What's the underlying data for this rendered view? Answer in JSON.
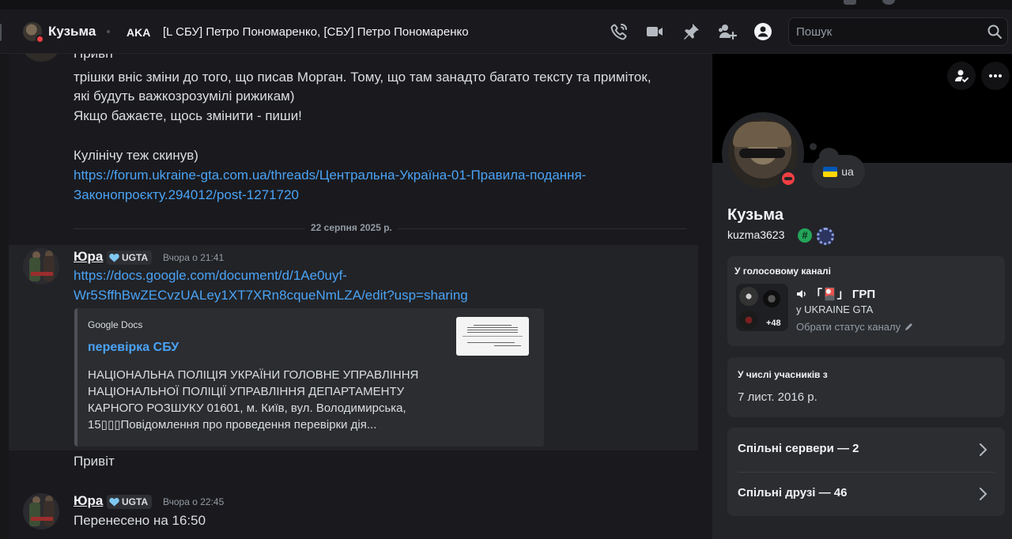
{
  "header": {
    "dm_name": "Кузьма",
    "aka_label": "AKA",
    "aka_names": "[L СБУ] Петро Пономаренко, [СБУ] Петро Пономаренко",
    "search_placeholder": "Пошук"
  },
  "chat": {
    "partial_message": {
      "lines": [
        "Привіт",
        "трішки вніс зміни до того, що писав Морган. Тому, що там занадто багато тексту та приміток,",
        "які будуть важкозрозумілі рижикам)",
        "Якщо бажаєте, щось змінити - пиши!",
        "Кулінічу теж скинув)"
      ],
      "link_line1": "https://forum.ukraine-gta.com.ua/threads/Центральна-Україна-01-Правила-подання-",
      "link_line2": "Законопроєкту.294012/post-1271720"
    },
    "date_divider": "22 серпня 2025 р.",
    "messages": [
      {
        "author": "Юра",
        "tag": "UGTA",
        "timestamp": "Вчора о 21:41",
        "link_line1": "https://docs.google.com/document/d/1Ae0uyf-",
        "link_line2": "Wr5SffhBwZECvzUALey1XT7XRn8cqueNmLZA/edit?usp=sharing",
        "embed": {
          "provider": "Google Docs",
          "title": "перевірка СБУ",
          "description": "НАЦІОНАЛЬНА ПОЛІЦІЯ УКРАЇНИ ГОЛОВНЕ УПРАВЛІННЯ НАЦІОНАЛЬНОЇ ПОЛІЦІЇ УПРАВЛІННЯ ДЕПАРТАМЕНТУ КАРНОГО РОЗШУКУ 01601, м. Київ, вул. Володимирська, 15▯▯▯Повідомлення про проведення перевірки дія..."
        },
        "followup": "Привіт"
      },
      {
        "author": "Юра",
        "tag": "UGTA",
        "timestamp": "Вчора о 22:45",
        "text": "Перенесено на 16:50"
      }
    ]
  },
  "profile": {
    "display_name": "Кузьма",
    "username": "kuzma3623",
    "status_text": "ua",
    "voice": {
      "title": "У голосовому каналі",
      "channel": "「🎴」 ГРП",
      "server": "у UKRAINE GTA",
      "status_hint": "Обрати статус каналу",
      "extra_count": "+48"
    },
    "member_since": {
      "title": "У числі учасників з",
      "date": "7 лист. 2016 р."
    },
    "mutual_servers": "Спільні сервери — 2",
    "mutual_friends": "Спільні друзі — 46"
  },
  "icons": [
    "phone-icon",
    "video-icon",
    "pin-icon",
    "add-friend-icon",
    "user-profile-icon",
    "search-icon",
    "voice-speaker-icon",
    "edit-pencil-icon",
    "chevron-right-icon",
    "more-icon"
  ],
  "colors": {
    "accent_link": "#4aa3f5",
    "dnd_red": "#f23f43",
    "online_green": "#23a55a",
    "background": "#1a1a1e",
    "panel": "#232428"
  }
}
